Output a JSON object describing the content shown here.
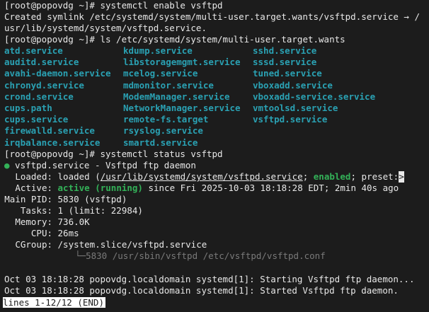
{
  "terminal": {
    "prompt": "[root@popovdg ~]# ",
    "cmd1": "systemctl enable vsftpd",
    "symlink_line1": "Created symlink /etc/systemd/system/multi-user.target.wants/vsftpd.service → /",
    "symlink_line2": "usr/lib/systemd/system/vsftpd.service.",
    "cmd2": "ls /etc/systemd/system/multi-user.target.wants",
    "ls_rows": [
      [
        "atd.service",
        "kdump.service",
        "sshd.service"
      ],
      [
        "auditd.service",
        "libstoragemgmt.service",
        "sssd.service"
      ],
      [
        "avahi-daemon.service",
        "mcelog.service",
        "tuned.service"
      ],
      [
        "chronyd.service",
        "mdmonitor.service",
        "vboxadd.service"
      ],
      [
        "crond.service",
        "ModemManager.service",
        "vboxadd-service.service"
      ],
      [
        "cups.path",
        "NetworkManager.service",
        "vmtoolsd.service"
      ],
      [
        "cups.service",
        "remote-fs.target",
        "vsftpd.service"
      ],
      [
        "firewalld.service",
        "rsyslog.service",
        ""
      ],
      [
        "irqbalance.service",
        "smartd.service",
        ""
      ]
    ],
    "cmd3": "systemctl status vsftpd",
    "status": {
      "bullet": "●",
      "unit_line": " vsftpd.service - Vsftpd ftp daemon",
      "loaded_label": "Loaded:",
      "loaded_pre": " loaded (",
      "loaded_path": "/usr/lib/systemd/system/vsftpd.service",
      "loaded_mid": "; ",
      "loaded_enabled": "enabled",
      "loaded_post": "; preset:",
      "overflow_marker": ">",
      "active_label": "Active:",
      "active_state": "active (running)",
      "active_since": " since Fri 2025-10-03 18:18:28 EDT; 2min 40s ago",
      "mainpid_label": "Main PID:",
      "mainpid_value": " 5830 (vsftpd)",
      "tasks_label": "Tasks:",
      "tasks_value": " 1 (limit: 22984)",
      "memory_label": "Memory:",
      "memory_value": " 736.0K",
      "cpu_label": "CPU:",
      "cpu_value": " 26ms",
      "cgroup_label": "CGroup:",
      "cgroup_value": " /system.slice/vsftpd.service",
      "tree_branch": "└─",
      "tree_process": "5830 /usr/sbin/vsftpd /etc/vsftpd/vsftpd.conf"
    },
    "log_lines": [
      "Oct 03 18:18:28 popovdg.localdomain systemd[1]: Starting Vsftpd ftp daemon...",
      "Oct 03 18:18:28 popovdg.localdomain systemd[1]: Started Vsftpd ftp daemon."
    ],
    "pager_status": "lines 1-12/12 (END)"
  },
  "colors": {
    "background": "#1c1c1c",
    "foreground": "#e8e8e8",
    "service_teal": "#2aa1b3",
    "active_green": "#33b158",
    "dim_grey": "#7a7a7a"
  }
}
